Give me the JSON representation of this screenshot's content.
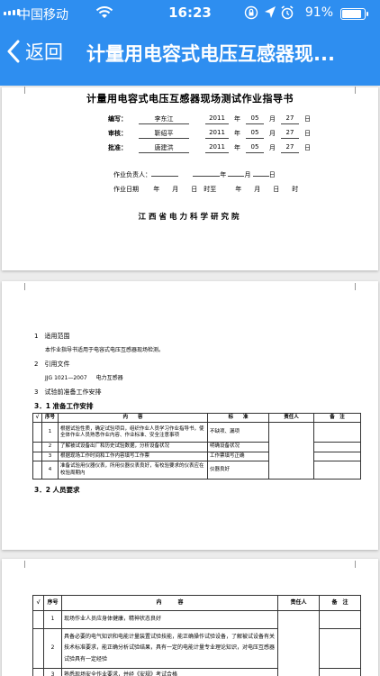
{
  "status_bar": {
    "carrier": "中国移动",
    "time": "16:23",
    "battery": "91%"
  },
  "nav": {
    "back_label": "返回",
    "title": "计量用电容式电压互感器现..."
  },
  "cover": {
    "title": "计量用电容式电压互感器现场测试作业指导书",
    "sign_rows": [
      {
        "label": "编写：",
        "name": "李东江",
        "year": "2011",
        "month": "05",
        "day": "27"
      },
      {
        "label": "审核：",
        "name": "靳绍平",
        "year": "2011",
        "month": "05",
        "day": "27"
      },
      {
        "label": "批准：",
        "name": "唐建洪",
        "year": "2011",
        "month": "05",
        "day": "27"
      }
    ],
    "unit_year": "年",
    "unit_month": "月",
    "unit_day": "日",
    "leader_label": "作业负责人：",
    "date_label": "作业日期",
    "date_line": "年　　月　　日　时至　　　年　　月　　日　　时",
    "institute": "江西省电力科学研究院"
  },
  "page2": {
    "s1_heading": "1　适用范围",
    "s1_text": "本作业指导书适用于电容式电压互感器现场检测。",
    "s2_heading": "2　引用文件",
    "s2_ref_code": "JJG 1021—2007",
    "s2_ref_name": "电力互感器",
    "s3_heading": "3　试验前准备工作安排",
    "s31_heading": "3．1 准备工作安排",
    "table_headers": [
      "√",
      "序号",
      "内　　容",
      "标　　准",
      "责任人",
      "备　注"
    ],
    "rows": [
      {
        "no": "1",
        "content": "根据试验性质，确定试验项目，组织作业人员学习作业指导书，使全体作业人员熟悉作业内容、作业标准、安全注意事项",
        "standard": "不缺项、漏项"
      },
      {
        "no": "2",
        "content": "了解被试设备出厂和历史试验数据，分析设备状况",
        "standard": "明确设备状况"
      },
      {
        "no": "3",
        "content": "根据现场工作时间和工作内容填写工作票",
        "standard": "工作票填写正确"
      },
      {
        "no": "4",
        "content": "准备试验用仪器仪表，所用仪器仪表良好，有校验要求的仪表应在校验周期内",
        "standard": "仪器良好"
      }
    ],
    "s32_heading": "3．2 人员要求"
  },
  "page3": {
    "table_headers": [
      "√",
      "序号",
      "内　　　容",
      "责任人",
      "备　注"
    ],
    "rows": [
      {
        "no": "1",
        "content": "现场作业人员应身体健康，精神状态良好"
      },
      {
        "no": "2",
        "content": "具备必要的电气知识和电能计量装置试验技能，能正确操作试验设备，了解被试设备有关技术标准要求，能正确分析试验结果，具有一定的电能计量专业理论知识，对电压互感器试验具有一定经验"
      },
      {
        "no": "3",
        "content": "熟悉现场安全作业要求，并经《安规》考试合格"
      }
    ]
  }
}
